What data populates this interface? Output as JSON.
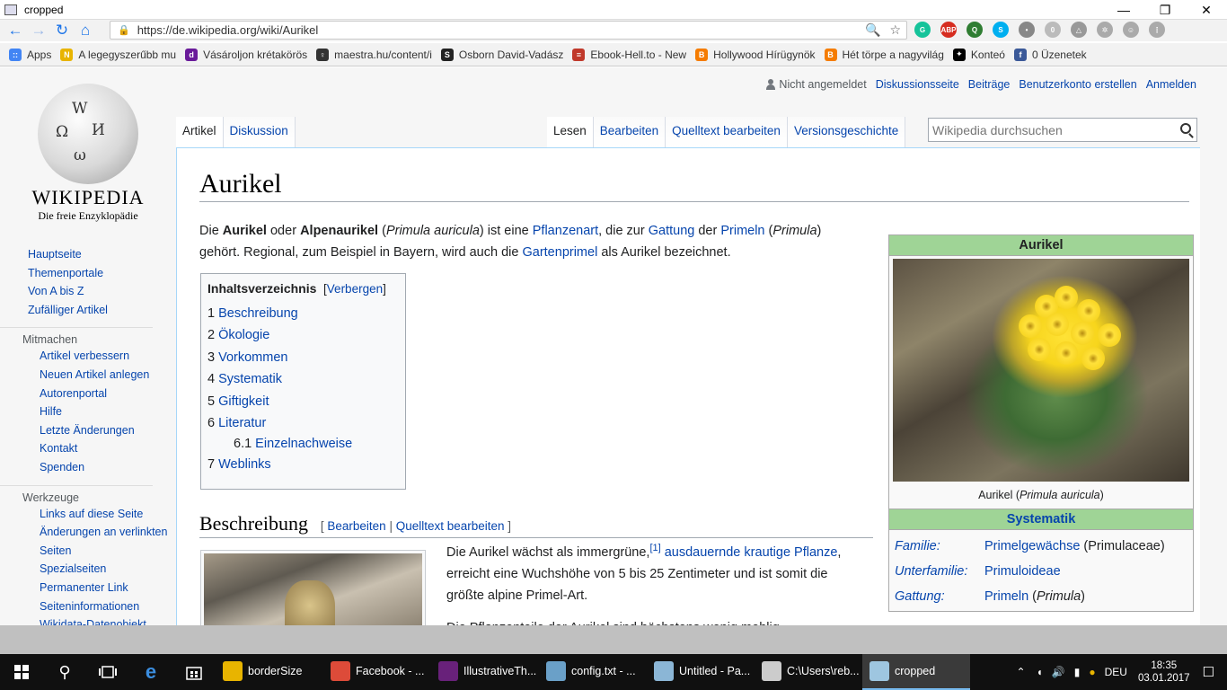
{
  "window": {
    "title": "cropped",
    "controls": [
      "—",
      "❐",
      "✕"
    ]
  },
  "browser": {
    "url": "https://de.wikipedia.org/wiki/Aurikel",
    "nav_icons": [
      "back-icon",
      "forward-icon",
      "reload-icon",
      "home-icon"
    ],
    "omni_icons": [
      "🔍",
      "☆"
    ],
    "extensions": [
      {
        "name": "grammarly",
        "color": "#15c39a",
        "label": "G"
      },
      {
        "name": "adblock",
        "color": "#d62d20",
        "label": "ABP"
      },
      {
        "name": "lastpass",
        "color": "#2f7d32",
        "label": "Q"
      },
      {
        "name": "skype",
        "color": "#00aff0",
        "label": "S"
      },
      {
        "name": "bulb",
        "color": "#888888",
        "label": "•"
      },
      {
        "name": "zero",
        "color": "#bbbbbb",
        "label": "0"
      },
      {
        "name": "drive",
        "color": "#999999",
        "label": "△"
      },
      {
        "name": "cog",
        "color": "#aaaaaa",
        "label": "✲"
      },
      {
        "name": "user",
        "color": "#aaaaaa",
        "label": "☺"
      },
      {
        "name": "menu",
        "color": "#aaaaaa",
        "label": "⋮"
      }
    ]
  },
  "bookmarks": [
    {
      "label": "Apps",
      "color": "#4285f4",
      "icon": "::"
    },
    {
      "label": "A legegyszerűbb mu",
      "color": "#e8b400",
      "icon": "N"
    },
    {
      "label": "Vásároljon krétakörös",
      "color": "#6a1b9a",
      "icon": "d"
    },
    {
      "label": "maestra.hu/content/i",
      "color": "#333333",
      "icon": "♀"
    },
    {
      "label": "Osborn David-Vadász",
      "color": "#222222",
      "icon": "S"
    },
    {
      "label": "Ebook-Hell.to - New",
      "color": "#c0392b",
      "icon": "≡"
    },
    {
      "label": "Hollywood Hírügynök",
      "color": "#f57c00",
      "icon": "B"
    },
    {
      "label": "Hét törpe a nagyvilág",
      "color": "#f57c00",
      "icon": "B"
    },
    {
      "label": "Konteó",
      "color": "#000000",
      "icon": "✦"
    },
    {
      "label": "0 Üzenetek",
      "color": "#3b5998",
      "icon": "f"
    }
  ],
  "wiki": {
    "logo": {
      "wordmark": "WIKIPEDIA",
      "tagline": "Die freie Enzyklopädie"
    },
    "personal": {
      "user": "Nicht angemeldet",
      "links": [
        "Diskussionsseite",
        "Beiträge",
        "Benutzerkonto erstellen",
        "Anmelden"
      ]
    },
    "sidebar": {
      "main": [
        "Hauptseite",
        "Themenportale",
        "Von A bis Z",
        "Zufälliger Artikel"
      ],
      "mitmachen_head": "Mitmachen",
      "mitmachen": [
        "Artikel verbessern",
        "Neuen Artikel anlegen",
        "Autorenportal",
        "Hilfe",
        "Letzte Änderungen",
        "Kontakt",
        "Spenden"
      ],
      "werkzeuge_head": "Werkzeuge",
      "werkzeuge": [
        "Links auf diese Seite",
        "Änderungen an verlinkten Seiten",
        "Spezialseiten",
        "Permanenter Link",
        "Seiteninformationen",
        "Wikidata-Datenobjekt"
      ]
    },
    "tabs_left": [
      "Artikel",
      "Diskussion"
    ],
    "tabs_right": [
      "Lesen",
      "Bearbeiten",
      "Quelltext bearbeiten",
      "Versionsgeschichte"
    ],
    "search_placeholder": "Wikipedia durchsuchen",
    "heading": "Aurikel",
    "lead": {
      "t1": "Die ",
      "b1": "Aurikel",
      "t2": " oder ",
      "b2": "Alpenaurikel",
      "t3": " (",
      "i1": "Primula auricula",
      "t4": ") ist eine ",
      "l1": "Pflanzenart",
      "t5": ", die zur ",
      "l2": "Gattung",
      "t6": " der ",
      "l3": "Primeln",
      "t7": " (",
      "i2": "Primula",
      "t8": ") gehört. Regional, zum Beispiel in Bayern, wird auch die ",
      "l4": "Gartenprimel",
      "t9": " als Aurikel bezeichnet."
    },
    "toc": {
      "title": "Inhaltsverzeichnis",
      "toggle": "Verbergen",
      "items": [
        {
          "num": "1",
          "label": "Beschreibung"
        },
        {
          "num": "2",
          "label": "Ökologie"
        },
        {
          "num": "3",
          "label": "Vorkommen"
        },
        {
          "num": "4",
          "label": "Systematik"
        },
        {
          "num": "5",
          "label": "Giftigkeit"
        },
        {
          "num": "6",
          "label": "Literatur"
        },
        {
          "num": "6.1",
          "label": "Einzelnachweise"
        },
        {
          "num": "7",
          "label": "Weblinks"
        }
      ]
    },
    "section": {
      "title": "Beschreibung",
      "edit": "Bearbeiten",
      "edit_source": "Quelltext bearbeiten"
    },
    "para1": {
      "t1": "Die Aurikel wächst als immergrüne,",
      "ref": "[1]",
      "l1": "ausdauernde",
      "l2": "krautige",
      "l3": "Pflanze",
      "t2": ", erreicht eine Wuchshöhe von 5 bis 25 Zentimeter und ist somit die größte alpine Primel-Art."
    },
    "para2": "Die Pflanzenteile der Aurikel sind höchstens wenig mehlig",
    "infobox": {
      "title": "Aurikel",
      "caption_pre": "Aurikel (",
      "caption_italic": "Primula auricula",
      "caption_post": ")",
      "systematik": "Systematik",
      "rows": [
        {
          "rank": "Familie:",
          "link": "Primelgewächse",
          "rest": " (Primulaceae)",
          "italic": ""
        },
        {
          "rank": "Unterfamilie:",
          "link": "Primuloideae",
          "rest": "",
          "italic": ""
        },
        {
          "rank": "Gattung:",
          "link": "Primeln",
          "rest": " (",
          "italic": "Primula",
          "close": ")"
        }
      ]
    }
  },
  "taskbar": {
    "tasks": [
      {
        "label": "borderSize",
        "color": "#e8b400",
        "active": false
      },
      {
        "label": "Facebook - ...",
        "color": "#dd4b39",
        "active": false
      },
      {
        "label": "IllustrativeTh...",
        "color": "#68217a",
        "active": false
      },
      {
        "label": "config.txt - ...",
        "color": "#6aa0c8",
        "active": false
      },
      {
        "label": "Untitled - Pa...",
        "color": "#8bb6d6",
        "active": false
      },
      {
        "label": "C:\\Users\\reb...",
        "color": "#cccccc",
        "active": false
      },
      {
        "label": "cropped",
        "color": "#9ec6e0",
        "active": true
      }
    ],
    "lang": "DEU",
    "time": "18:35",
    "date": "03.01.2017"
  }
}
